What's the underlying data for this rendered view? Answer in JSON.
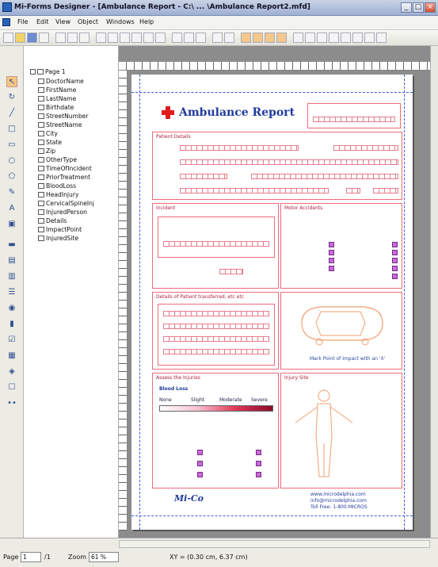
{
  "window": {
    "title": "Mi-Forms Designer - [Ambulance Report - C:\\ ... \\Ambulance Report2.mfd]",
    "minimize": "_",
    "maximize": "□",
    "close": "×"
  },
  "menu": [
    "File",
    "Edit",
    "View",
    "Object",
    "Windows",
    "Help"
  ],
  "tree": {
    "root": "Page 1",
    "items": [
      "DoctorName",
      "FirstName",
      "LastName",
      "Birthdate",
      "StreetNumber",
      "StreetName",
      "City",
      "State",
      "Zip",
      "OtherType",
      "TimeOfIncident",
      "PriorTreatment",
      "BloodLoss",
      "HeadInjury",
      "CervicalSpineInj",
      "InjuredPerson",
      "Details",
      "ImpactPoint",
      "InjuredSite"
    ]
  },
  "form": {
    "title": "Ambulance Report",
    "sections": {
      "patient": "Patient Details",
      "incident": "Incident",
      "vehicle": "Motor Accidents",
      "details": "Details of Patient transferred, etc etc",
      "injury": "Assess the Injuries",
      "body": "Injury Site"
    },
    "vehicle_hint": "Mark Point of Impact with an 'X'",
    "blood_loss": "Blood Loss",
    "blood_scale": [
      "None",
      "Slight",
      "Moderate",
      "Severe"
    ],
    "logo": "Mi-Co",
    "contact": [
      "www.microdelphia.com",
      "info@microdelphia.com",
      "Toll Free: 1-800-MICROS"
    ]
  },
  "status": {
    "page_label": "Page",
    "page_value": "1",
    "page_total": "/1",
    "zoom_label": "Zoom",
    "zoom_value": "61 %",
    "coords": "XY = (0.30 cm, 6.37 cm)"
  }
}
